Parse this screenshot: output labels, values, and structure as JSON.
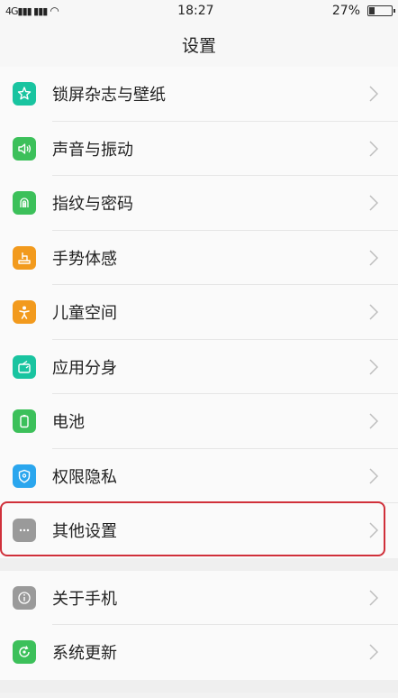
{
  "status": {
    "signal": "ᵢıl ᵢıl",
    "time": "18:27",
    "battery": "27%",
    "battery_level": 0.27
  },
  "header": {
    "title": "设置"
  },
  "group1": [
    {
      "label": "锁屏杂志与壁纸",
      "icon": "wallpaper-icon",
      "color": "#19c4a0"
    },
    {
      "label": "声音与振动",
      "icon": "speaker-icon",
      "color": "#3cc05a"
    },
    {
      "label": "指纹与密码",
      "icon": "fingerprint-icon",
      "color": "#3cc05a"
    },
    {
      "label": "手势体感",
      "icon": "gesture-icon",
      "color": "#f29a1d"
    },
    {
      "label": "儿童空间",
      "icon": "child-icon",
      "color": "#f29a1d"
    },
    {
      "label": "应用分身",
      "icon": "clone-icon",
      "color": "#19c4a0"
    },
    {
      "label": "电池",
      "icon": "battery-icon",
      "color": "#3cc05a"
    },
    {
      "label": "权限隐私",
      "icon": "shield-icon",
      "color": "#2aa6ee"
    },
    {
      "label": "其他设置",
      "icon": "more-icon",
      "color": "#9a9a9a"
    }
  ],
  "group2": [
    {
      "label": "关于手机",
      "icon": "info-icon",
      "color": "#9a9a9a"
    },
    {
      "label": "系统更新",
      "icon": "update-icon",
      "color": "#3cc05a"
    }
  ]
}
